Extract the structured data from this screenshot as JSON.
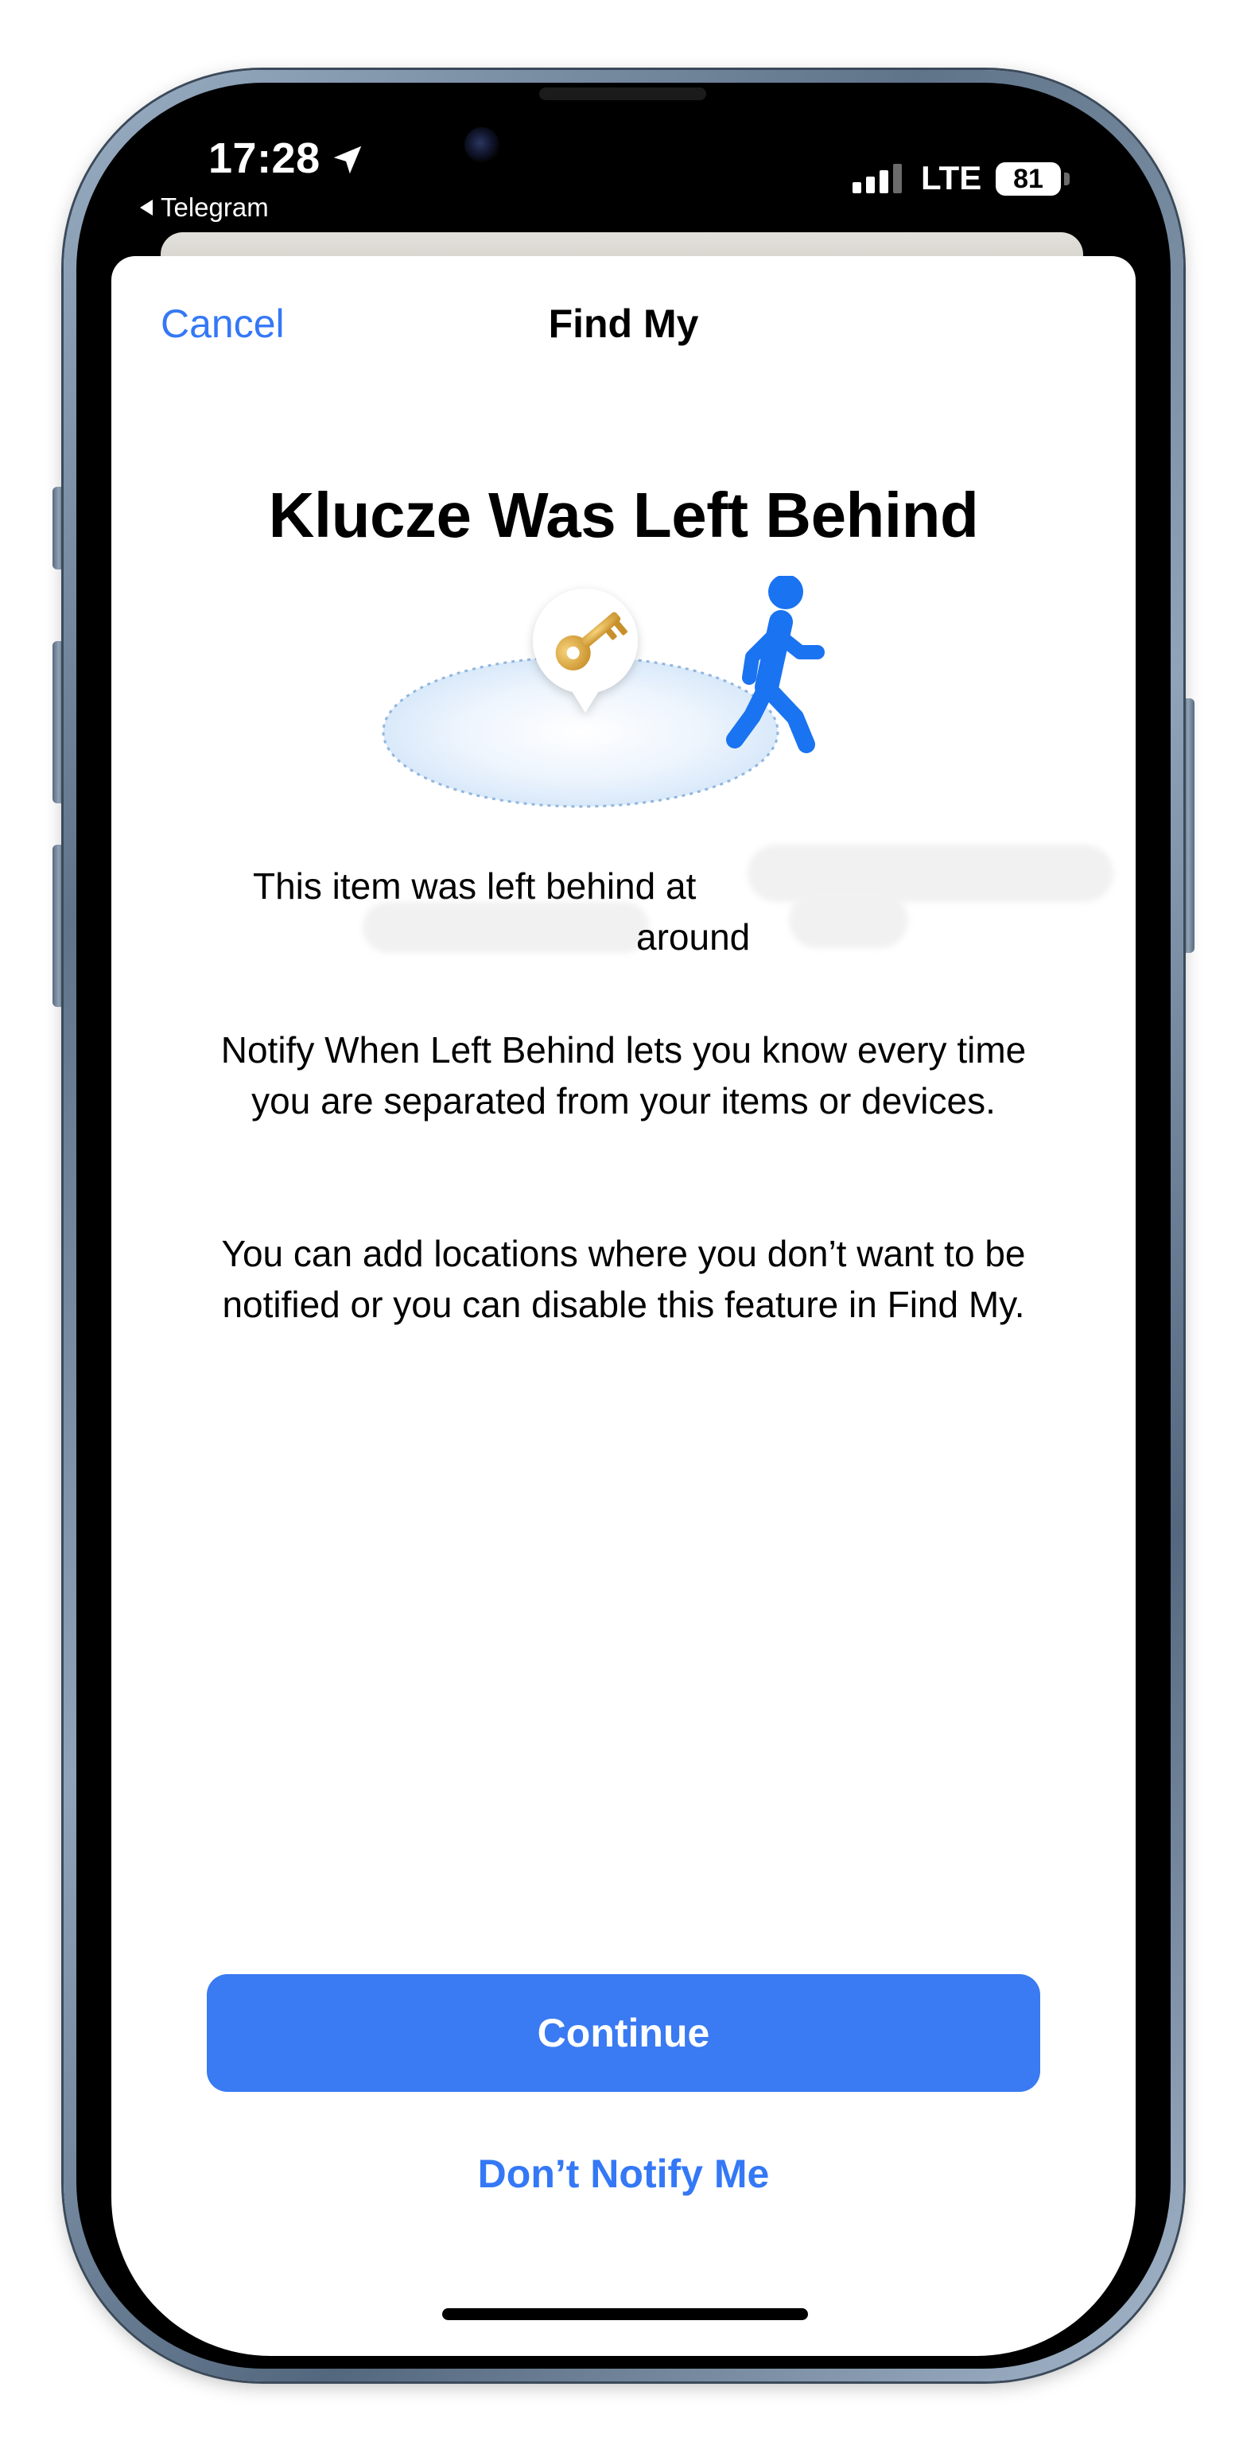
{
  "status_bar": {
    "time": "17:28",
    "back_app": "Telegram",
    "network": "LTE",
    "battery": "81"
  },
  "nav": {
    "cancel_label": "Cancel",
    "title": "Find My"
  },
  "main": {
    "headline": "Klucze Was Left Behind",
    "left_behind_text": "This item was left behind at",
    "around_text": "around",
    "notify_text": "Notify When Left Behind lets you know every time you are separated from your items or devices.",
    "locations_text": "You can add locations where you don’t want to be notified or you can disable this feature in Find My."
  },
  "actions": {
    "continue_label": "Continue",
    "dont_notify_label": "Don’t Notify Me"
  },
  "icons": {
    "item": "key-icon",
    "person": "walking-person-icon",
    "location": "location-arrow-icon"
  },
  "colors": {
    "accent": "#3478f6",
    "button": "#3a7af2",
    "key": "#e6b34a",
    "walker": "#1a73f0"
  }
}
